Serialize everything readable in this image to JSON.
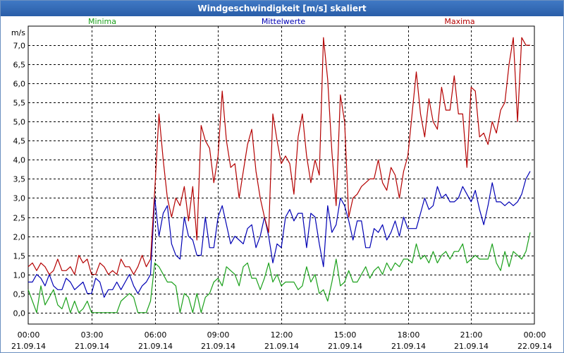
{
  "window": {
    "title": "Windgeschwindigkeit [m/s] skaliert"
  },
  "colors": {
    "minima": "#1aa01a",
    "mittelwerte": "#0000b4",
    "maxima": "#b40000",
    "grid": "#000000"
  },
  "chart_data": {
    "type": "line",
    "title": "Windgeschwindigkeit [m/s] skaliert",
    "ylabel": "m/s",
    "ylim": [
      -0.3,
      7.5
    ],
    "yticks": [
      "0,0",
      "0,5",
      "1,0",
      "1,5",
      "2,0",
      "2,5",
      "3,0",
      "3,5",
      "4,0",
      "4,5",
      "5,0",
      "5,5",
      "6,0",
      "6,5",
      "7,0"
    ],
    "xlim": [
      0,
      24
    ],
    "xticks": [
      {
        "time": "00:00",
        "date": "21.09.14"
      },
      {
        "time": "03:00",
        "date": "21.09.14"
      },
      {
        "time": "06:00",
        "date": "21.09.14"
      },
      {
        "time": "09:00",
        "date": "21.09.14"
      },
      {
        "time": "12:00",
        "date": "21.09.14"
      },
      {
        "time": "15:00",
        "date": "21.09.14"
      },
      {
        "time": "18:00",
        "date": "21.09.14"
      },
      {
        "time": "21:00",
        "date": "21.09.14"
      },
      {
        "time": "00:00",
        "date": "22.09.14"
      }
    ],
    "grid": true,
    "x": [
      0.0,
      0.2,
      0.4,
      0.6,
      0.8,
      1.0,
      1.2,
      1.4,
      1.6,
      1.8,
      2.0,
      2.2,
      2.4,
      2.6,
      2.8,
      3.0,
      3.2,
      3.4,
      3.6,
      3.8,
      4.0,
      4.2,
      4.4,
      4.6,
      4.8,
      5.0,
      5.2,
      5.4,
      5.6,
      5.8,
      6.0,
      6.2,
      6.4,
      6.6,
      6.8,
      7.0,
      7.2,
      7.4,
      7.6,
      7.8,
      8.0,
      8.2,
      8.4,
      8.6,
      8.8,
      9.0,
      9.2,
      9.4,
      9.6,
      9.8,
      10.0,
      10.2,
      10.4,
      10.6,
      10.8,
      11.0,
      11.2,
      11.4,
      11.6,
      11.8,
      12.0,
      12.2,
      12.4,
      12.6,
      12.8,
      13.0,
      13.2,
      13.4,
      13.6,
      13.8,
      14.0,
      14.2,
      14.4,
      14.6,
      14.8,
      15.0,
      15.2,
      15.4,
      15.6,
      15.8,
      16.0,
      16.2,
      16.4,
      16.6,
      16.8,
      17.0,
      17.2,
      17.4,
      17.6,
      17.8,
      18.0,
      18.2,
      18.4,
      18.6,
      18.8,
      19.0,
      19.2,
      19.4,
      19.6,
      19.8,
      20.0,
      20.2,
      20.4,
      20.6,
      20.8,
      21.0,
      21.2,
      21.4,
      21.6,
      21.8,
      22.0,
      22.2,
      22.4,
      22.6,
      22.8,
      23.0,
      23.2,
      23.4,
      23.6,
      23.8
    ],
    "series": [
      {
        "name": "Minima",
        "color": "#1aa01a",
        "values": [
          0.6,
          0.3,
          0.0,
          0.7,
          0.2,
          0.4,
          0.6,
          0.2,
          0.1,
          0.4,
          0.0,
          0.3,
          0.0,
          0.1,
          0.3,
          0.0,
          0.0,
          0.0,
          0.0,
          0.0,
          0.0,
          0.0,
          0.3,
          0.4,
          0.5,
          0.4,
          0.0,
          0.0,
          0.0,
          0.3,
          1.3,
          1.2,
          1.0,
          0.8,
          0.8,
          0.7,
          0.0,
          0.5,
          0.4,
          0.0,
          0.5,
          0.0,
          0.4,
          0.5,
          0.8,
          0.9,
          0.7,
          1.2,
          1.1,
          1.0,
          0.7,
          1.2,
          1.3,
          0.9,
          0.9,
          0.6,
          0.9,
          1.3,
          0.8,
          1.0,
          0.7,
          0.8,
          0.8,
          0.8,
          0.6,
          0.7,
          1.2,
          0.8,
          1.0,
          0.5,
          0.6,
          0.3,
          0.8,
          1.4,
          0.7,
          0.8,
          1.1,
          0.8,
          0.8,
          1.0,
          1.2,
          0.9,
          1.1,
          1.2,
          1.0,
          1.3,
          1.1,
          1.3,
          1.2,
          1.4,
          1.4,
          1.3,
          1.8,
          1.4,
          1.5,
          1.3,
          1.6,
          1.3,
          1.5,
          1.6,
          1.4,
          1.6,
          1.6,
          1.8,
          1.3,
          1.4,
          1.5,
          1.4,
          1.4,
          1.4,
          1.8,
          1.3,
          1.1,
          1.6,
          1.2,
          1.6,
          1.5,
          1.4,
          1.6,
          2.1
        ]
      },
      {
        "name": "Mittelwerte",
        "color": "#0000b4",
        "values": [
          0.8,
          0.8,
          1.0,
          0.9,
          0.7,
          1.0,
          0.7,
          0.6,
          0.6,
          0.9,
          0.8,
          0.6,
          0.7,
          0.8,
          0.5,
          0.5,
          0.9,
          0.8,
          0.4,
          0.6,
          0.6,
          0.8,
          0.6,
          0.8,
          1.0,
          0.7,
          0.5,
          0.7,
          0.8,
          1.0,
          3.0,
          2.0,
          2.6,
          2.8,
          1.8,
          1.5,
          1.4,
          2.5,
          2.0,
          1.9,
          1.5,
          1.5,
          2.5,
          1.7,
          1.7,
          2.5,
          2.8,
          2.3,
          1.8,
          2.0,
          1.9,
          1.8,
          2.2,
          2.3,
          1.7,
          2.0,
          2.5,
          2.0,
          1.3,
          1.8,
          1.7,
          2.5,
          2.7,
          2.4,
          2.6,
          2.6,
          1.7,
          2.6,
          2.5,
          1.8,
          1.2,
          2.8,
          2.1,
          2.3,
          3.0,
          2.8,
          2.4,
          1.9,
          2.4,
          2.4,
          1.7,
          1.7,
          2.2,
          2.1,
          2.3,
          1.9,
          2.1,
          2.4,
          2.0,
          2.5,
          2.2,
          2.2,
          2.2,
          2.6,
          3.0,
          2.7,
          2.8,
          3.3,
          3.0,
          3.1,
          2.9,
          2.9,
          3.0,
          3.3,
          3.1,
          2.9,
          3.2,
          2.7,
          2.3,
          2.8,
          3.4,
          2.9,
          2.9,
          2.8,
          2.9,
          2.8,
          2.9,
          3.1,
          3.5,
          3.7
        ]
      },
      {
        "name": "Maxima",
        "color": "#b40000",
        "values": [
          1.2,
          1.3,
          1.1,
          1.3,
          1.2,
          1.0,
          1.1,
          1.4,
          1.1,
          1.1,
          1.2,
          1.0,
          1.5,
          1.3,
          1.4,
          1.0,
          1.0,
          1.3,
          1.2,
          1.0,
          1.1,
          1.0,
          1.4,
          1.2,
          1.2,
          1.0,
          1.2,
          1.5,
          1.2,
          1.4,
          3.2,
          5.2,
          4.0,
          3.0,
          2.5,
          3.0,
          2.8,
          3.3,
          2.4,
          3.3,
          1.9,
          4.9,
          4.5,
          4.3,
          3.4,
          4.1,
          5.8,
          4.5,
          3.8,
          3.9,
          3.0,
          3.7,
          4.4,
          4.8,
          3.7,
          3.0,
          2.5,
          2.1,
          5.2,
          4.5,
          3.9,
          4.1,
          3.9,
          3.1,
          4.6,
          5.2,
          4.1,
          3.4,
          4.0,
          3.6,
          7.2,
          6.1,
          4.2,
          2.8,
          5.7,
          5.0,
          2.5,
          3.0,
          3.1,
          3.3,
          3.4,
          3.5,
          3.5,
          4.0,
          3.4,
          3.2,
          3.8,
          3.6,
          3.0,
          3.7,
          4.1,
          5.2,
          6.3,
          5.2,
          4.6,
          5.6,
          5.0,
          4.8,
          5.9,
          5.3,
          5.3,
          6.2,
          5.2,
          5.2,
          3.8,
          5.9,
          5.8,
          4.6,
          4.7,
          4.4,
          5.0,
          4.7,
          5.3,
          5.5,
          6.5,
          7.2,
          5.0,
          7.2,
          7.0,
          7.0
        ]
      }
    ],
    "legend": [
      {
        "label": "Minima",
        "position": "top-left"
      },
      {
        "label": "Mittelwerte",
        "position": "top-center"
      },
      {
        "label": "Maxima",
        "position": "top-right"
      }
    ]
  }
}
